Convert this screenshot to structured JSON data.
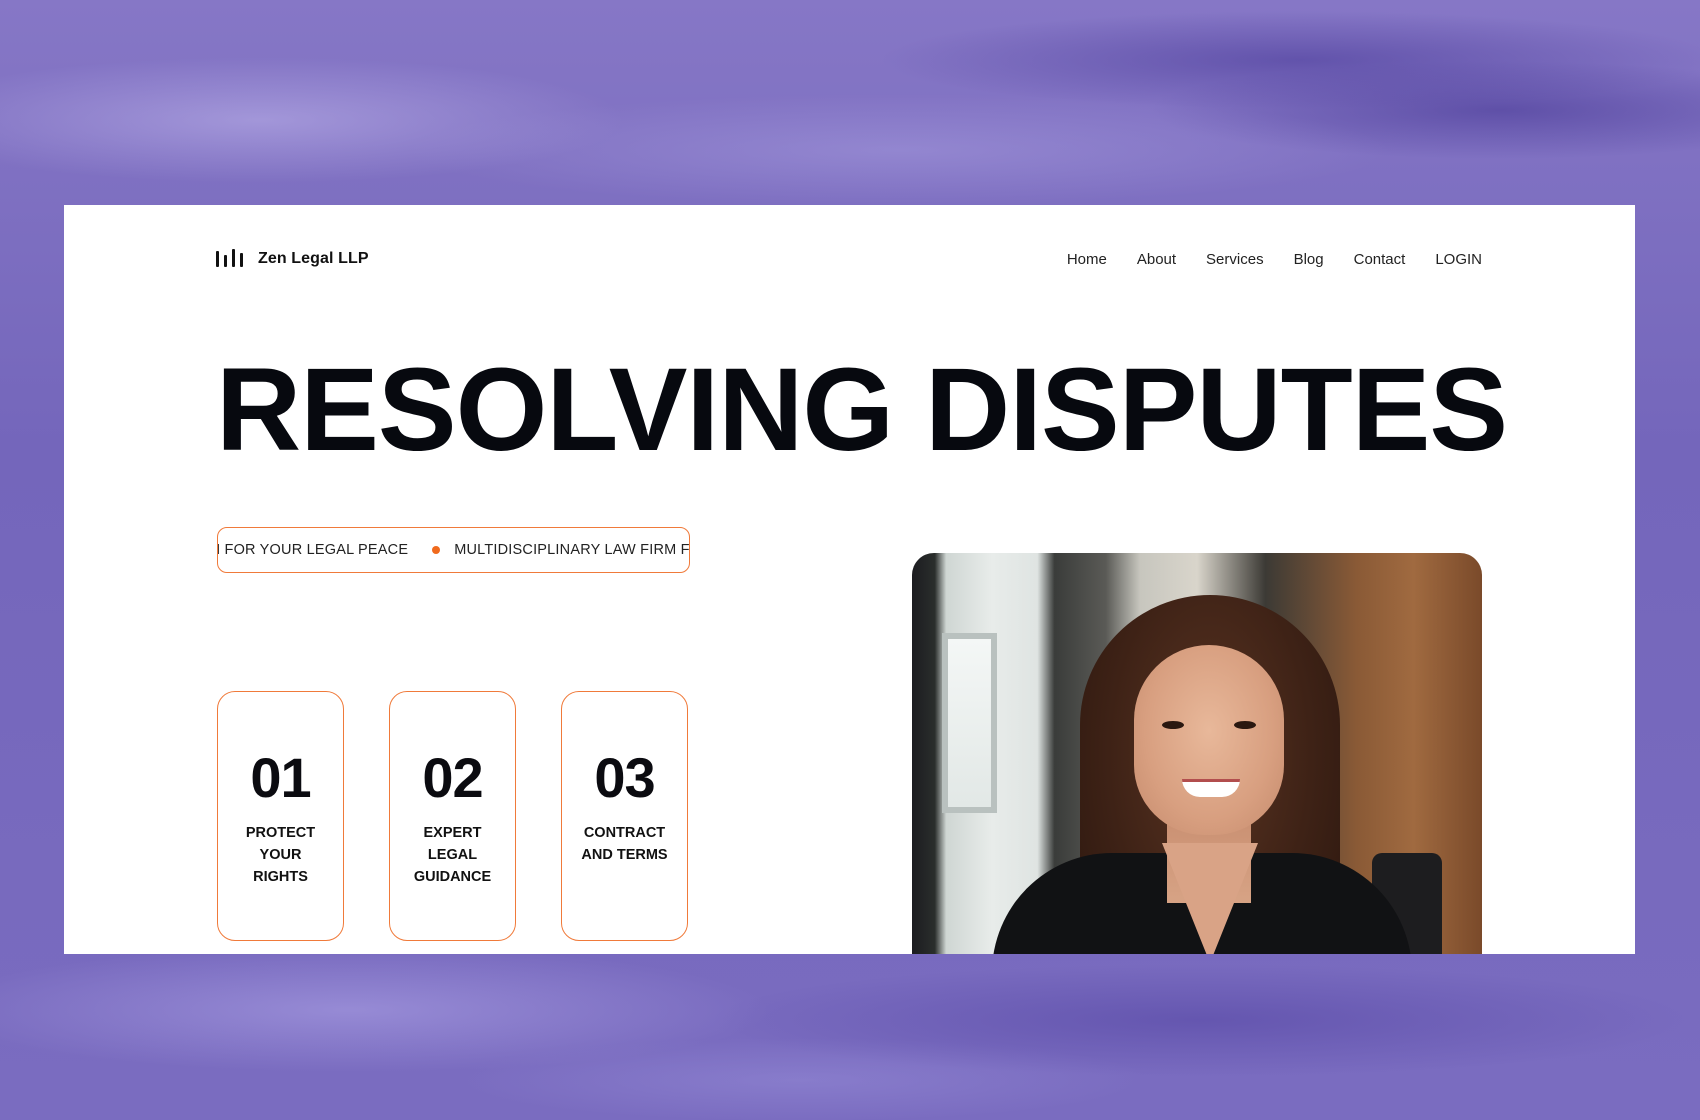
{
  "brand": {
    "name": "Zen Legal LLP",
    "logo_icon": "bars-logo-icon"
  },
  "nav": {
    "items": [
      "Home",
      "About",
      "Services",
      "Blog",
      "Contact",
      "LOGIN"
    ]
  },
  "hero": {
    "title": "RESOLVING DISPUTES"
  },
  "ticker": {
    "items": [
      "M FOR YOUR LEGAL PEACE",
      "MULTIDISCIPLINARY LAW FIRM F"
    ],
    "dot_color": "#f06a1d"
  },
  "cards": [
    {
      "number": "01",
      "label": "PROTECT YOUR RIGHTS"
    },
    {
      "number": "02",
      "label": "EXPERT LEGAL GUIDANCE"
    },
    {
      "number": "03",
      "label": "CONTRACT AND TERMS"
    }
  ],
  "colors": {
    "accent": "#f07a3a",
    "text": "#07090f",
    "backdrop": "#7d70c0"
  }
}
